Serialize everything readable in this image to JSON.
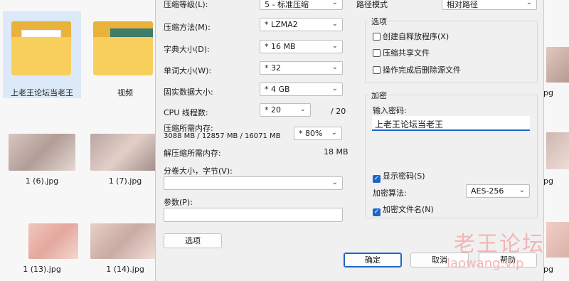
{
  "explorer": {
    "folders": [
      {
        "label": "上老王论坛当老王"
      },
      {
        "label": "视频"
      }
    ],
    "images": [
      {
        "label": "1 (6).jpg"
      },
      {
        "label": "1 (7).jpg"
      },
      {
        "label": "1 (13).jpg"
      },
      {
        "label": "1 (14).jpg"
      }
    ],
    "right_edge_captions": [
      "pg",
      "pg",
      "pg"
    ]
  },
  "dialog": {
    "compression_level": {
      "label": "压缩等级(L):",
      "value": "5 - 标准压缩"
    },
    "compression_method": {
      "label": "压缩方法(M):",
      "value": "* LZMA2"
    },
    "dictionary_size": {
      "label": "字典大小(D):",
      "value": "* 16 MB"
    },
    "word_size": {
      "label": "单词大小(W):",
      "value": "* 32"
    },
    "solid_block_size": {
      "label": "固实数据大小:",
      "value": "* 4 GB"
    },
    "cpu_threads": {
      "label": "CPU 线程数:",
      "value": "* 20",
      "max": "/ 20"
    },
    "memory_compress": {
      "label": "压缩所需内存:",
      "detail": "3088 MB / 12857 MB / 16071 MB",
      "value": "* 80%"
    },
    "memory_decompress": {
      "label": "解压缩所需内存:",
      "value": "18 MB"
    },
    "split_volumes": {
      "label": "分卷大小，字节(V):",
      "value": ""
    },
    "parameters": {
      "label": "参数(P):",
      "value": ""
    },
    "options_button": "选项",
    "path_mode": {
      "label": "路径模式",
      "value": "相对路径"
    },
    "options_group": {
      "title": "选项",
      "items": [
        {
          "label": "创建自释放程序(X)",
          "checked": false
        },
        {
          "label": "压缩共享文件",
          "checked": false
        },
        {
          "label": "操作完成后删除源文件",
          "checked": false
        }
      ]
    },
    "encryption_group": {
      "title": "加密",
      "password_label": "输入密码:",
      "password_value": "上老王论坛当老王",
      "show_password": {
        "label": "显示密码(S)",
        "checked": true
      },
      "method_label": "加密算法:",
      "method_value": "AES-256",
      "encrypt_names": {
        "label": "加密文件名(N)",
        "checked": true
      }
    },
    "buttons": {
      "ok": "确定",
      "cancel": "取消",
      "help": "帮助"
    }
  },
  "watermark": {
    "line1": "老王论坛",
    "line2": "laowang.vip"
  },
  "colors": {
    "accent": "#1d66c7",
    "folder": "#f8cf5d",
    "watermark": "#f3b6b6"
  }
}
